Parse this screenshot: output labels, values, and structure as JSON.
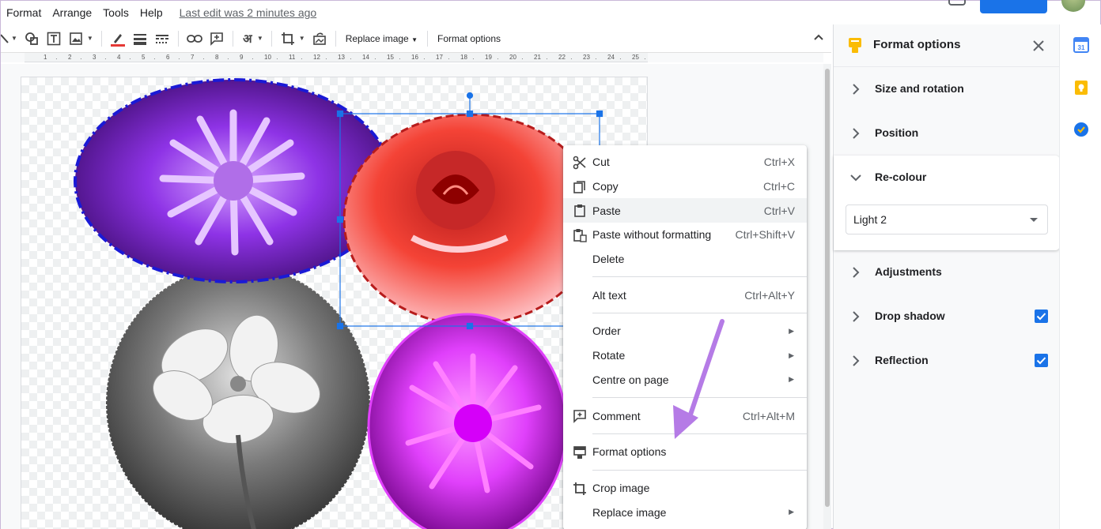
{
  "menubar": {
    "items": [
      "Format",
      "Arrange",
      "Tools",
      "Help"
    ],
    "last_edit": "Last edit was 2 minutes ago"
  },
  "toolbar": {
    "replace_image": "Replace image",
    "format_options": "Format options",
    "hindi_char": "अ"
  },
  "ruler": {
    "ticks": [
      "1",
      "2",
      "3",
      "4",
      "5",
      "6",
      "7",
      "8",
      "9",
      "10",
      "11",
      "12",
      "13",
      "14",
      "15",
      "16",
      "17",
      "18",
      "19",
      "20",
      "21",
      "22",
      "23",
      "24",
      "25"
    ]
  },
  "context_menu": {
    "items": [
      {
        "label": "Cut",
        "shortcut": "Ctrl+X",
        "icon": "scissors-icon"
      },
      {
        "label": "Copy",
        "shortcut": "Ctrl+C",
        "icon": "copy-icon"
      },
      {
        "label": "Paste",
        "shortcut": "Ctrl+V",
        "icon": "clipboard-icon",
        "highlight": true
      },
      {
        "label": "Paste without formatting",
        "shortcut": "Ctrl+Shift+V",
        "icon": "paste-plain-icon"
      },
      {
        "label": "Delete",
        "shortcut": ""
      },
      {
        "label": "Alt text",
        "shortcut": "Ctrl+Alt+Y"
      },
      {
        "label": "Order",
        "submenu": true
      },
      {
        "label": "Rotate",
        "submenu": true
      },
      {
        "label": "Centre on page",
        "submenu": true
      },
      {
        "label": "Comment",
        "shortcut": "Ctrl+Alt+M",
        "icon": "comment-icon"
      },
      {
        "label": "Format options",
        "icon": "format-options-icon"
      },
      {
        "label": "Crop image",
        "icon": "crop-icon"
      },
      {
        "label": "Replace image",
        "submenu": true
      }
    ]
  },
  "panel": {
    "title": "Format options",
    "sections": {
      "size_rotation": "Size and rotation",
      "position": "Position",
      "recolour": "Re-colour",
      "adjustments": "Adjustments",
      "drop_shadow": "Drop shadow",
      "reflection": "Reflection"
    },
    "recolour_value": "Light 2",
    "drop_shadow_checked": true,
    "reflection_checked": true
  },
  "colors": {
    "accent": "#1a73e8",
    "purple_flower": "#8a2be2",
    "red_flower": "#e53935",
    "magenta_flower": "#e040fb",
    "arrow": "#b57be6"
  },
  "rail": {
    "calendar_day": "31"
  }
}
